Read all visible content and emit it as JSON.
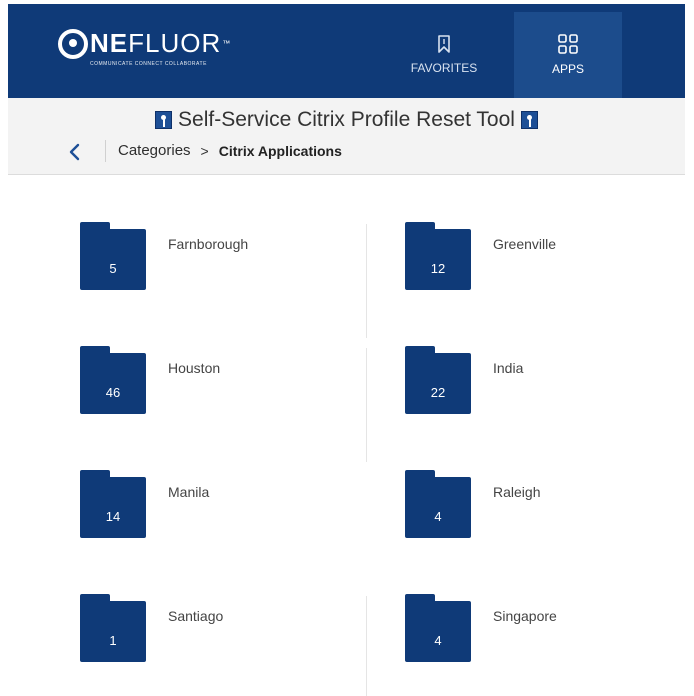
{
  "brand": {
    "name_part1": "NE",
    "name_part2": "FLUOR",
    "trademark": "™",
    "tagline": "COMMUNICATE  CONNECT  COLLABORATE"
  },
  "nav": {
    "tabs": [
      {
        "label": "FAVORITES",
        "icon": "bookmark-icon",
        "active": false
      },
      {
        "label": "APPS",
        "icon": "grid-icon",
        "active": true
      }
    ]
  },
  "page": {
    "title": "Self-Service Citrix Profile Reset Tool",
    "title_icon": "tool-icon",
    "breadcrumb": {
      "parent": "Categories",
      "current": "Citrix Applications"
    }
  },
  "categories": [
    {
      "name": "Farnborough",
      "count": "5"
    },
    {
      "name": "Greenville",
      "count": "12"
    },
    {
      "name": "Houston",
      "count": "46"
    },
    {
      "name": "India",
      "count": "22"
    },
    {
      "name": "Manila",
      "count": "14"
    },
    {
      "name": "Raleigh",
      "count": "4"
    },
    {
      "name": "Santiago",
      "count": "1"
    },
    {
      "name": "Singapore",
      "count": "4"
    }
  ],
  "colors": {
    "brand_navy": "#0f3a78",
    "active_tab": "#1c4c8c",
    "header_bg": "#f3f3f3"
  }
}
